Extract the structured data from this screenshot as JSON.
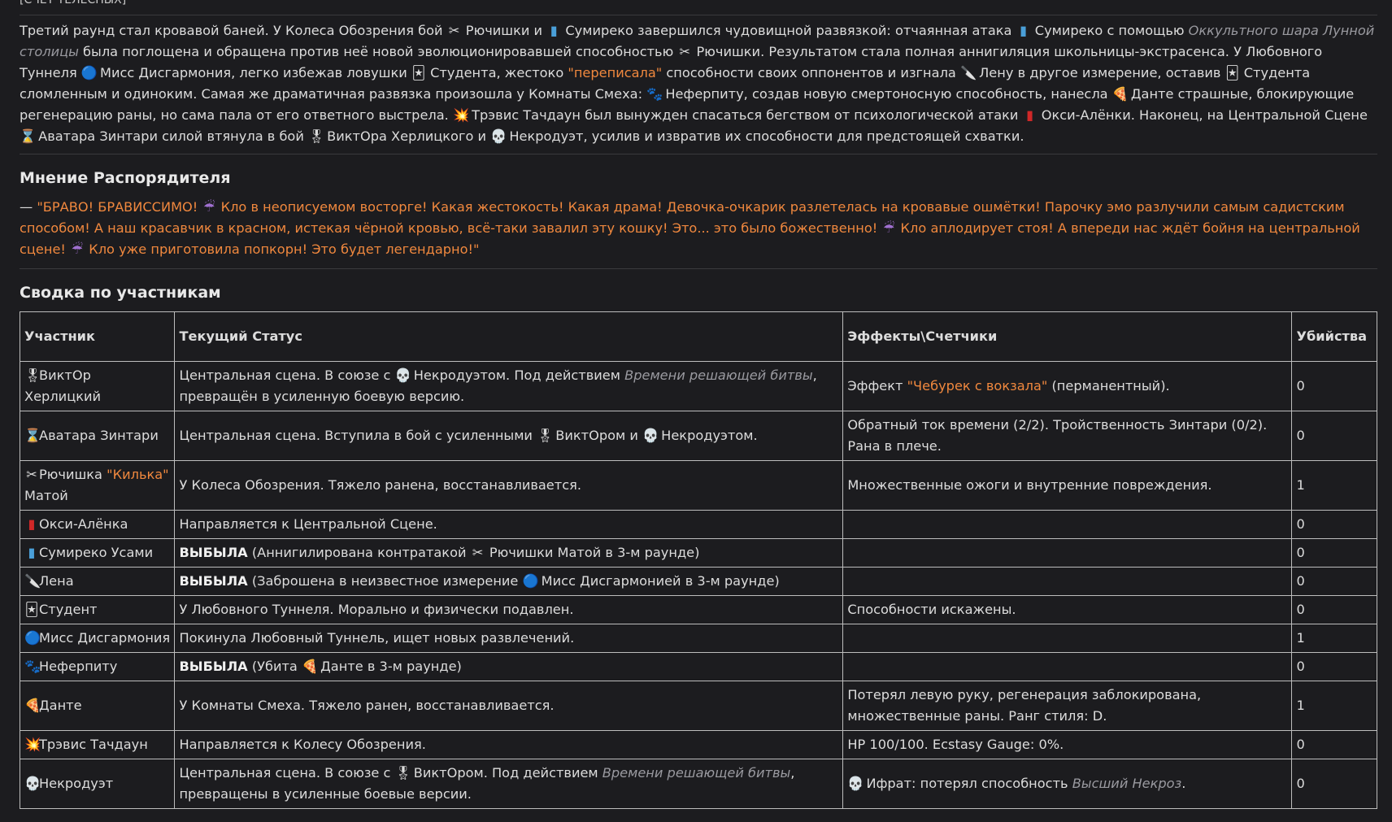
{
  "top_cut_text": "[СЧЕТ ТЕЛЕСНЫХ]",
  "story": {
    "s1": "Третий раунд стал кровавой баней. У Колеса Обозрения бой ",
    "s2": " Рючишки и ",
    "s3": " Сумиреко завершился чудовищной развязкой: отчаянная атака ",
    "s4": " Сумиреко с помощью ",
    "s4_it": "Оккультного шара Лунной столицы",
    "s5": " была поглощена и обращена против неё новой эволюционировавшей способностью ",
    "s6": " Рючишки. Результатом стала полная аннигиляция школьницы-экстрасенса. У Любовного Туннеля ",
    "s7": " Мисс Дисгармония, легко избежав ловушки ",
    "s8": " Студента, жестоко ",
    "s8_or": "\"переписала\"",
    "s9": " способности своих оппонентов и изгнала ",
    "s10": " Лену в другое измерение, оставив ",
    "s11": " Студента сломленным и одиноким. Самая же драматичная развязка произошла у Комнаты Смеха: ",
    "s12": " Неферпиту, создав новую смертоносную способность, нанесла ",
    "s13": " Данте страшные, блокирующие регенерацию раны, но сама пала от его ответного выстрела. ",
    "s14": " Трэвис Тачдаун был вынужден спасаться бегством от психологической атаки ",
    "s15": " Окси-Алёнки. Наконец, на Центральной Сцене ",
    "s16": " Аватара Зинтари силой втянула в бой ",
    "s17": " ВиктОра Херлицкого и ",
    "s18": " Некродуэт, усилив и извратив их способности для предстоящей схватки."
  },
  "opinion": {
    "heading": "Мнение Распорядителя",
    "dash": "— ",
    "q1": "\"БРАВО! БРАВИССИМО! ",
    "q2": " Кло в неописуемом восторге! Какая жестокость! Какая драма! Девочка-очкарик разлетелась на кровавые ошмётки! Парочку эмо разлучили самым садистским способом! А наш красавчик в красном, истекая чёрной кровью, всё-таки завалил эту кошку! Это... это было божественно! ",
    "q3": " Кло аплодирует стоя! А впереди нас ждёт бойня на центральной сцене! ",
    "q4": " Кло уже приготовила попкорн! Это будет легендарно!\""
  },
  "summary": {
    "heading": "Сводка по участникам",
    "columns": [
      "Участник",
      "Текущий Статус",
      "Эффекты\\Счетчики",
      "Убийства"
    ],
    "rows": [
      {
        "icon": "🎖",
        "name": "ВиктОр Херлицкий",
        "st1": "Центральная сцена. В союзе с ",
        "st_icon": "💀",
        "st2": " Некродуэтом. Под действием ",
        "st_it": "Времени решающей битвы",
        "st3": ", превращён в усиленную боевую версию.",
        "eff1": "Эффект ",
        "eff_or": "\"Чебурек с вокзала\"",
        "eff2": " (перманентный).",
        "kills": "0"
      },
      {
        "icon": "⌛",
        "name": "Аватара Зинтари",
        "st1": "Центральная сцена. Вступила в бой с усиленными ",
        "st_icon": "🎖",
        "st2": " ВиктОром и ",
        "st_icon2": "💀",
        "st3": " Некродуэтом.",
        "eff1": "Обратный ток времени (2/2). Тройственность Зинтари (0/2). Рана в плече.",
        "kills": "0"
      },
      {
        "icon": "✂",
        "name": "Рючишка ",
        "name_or": "\"Килька\"",
        "name2": " Матой",
        "st1": "У Колеса Обозрения. Тяжело ранена, восстанавливается.",
        "eff1": "Множественные ожоги и внутренние повреждения.",
        "kills": "1"
      },
      {
        "icon": "▮",
        "name": "Окси-Алёнка",
        "st1": "Направляется к Центральной Сцене.",
        "eff1": "",
        "kills": "0"
      },
      {
        "icon": "▮",
        "name": "Сумиреко Усами",
        "st_b": "ВЫБЫЛА",
        "st1": " (Аннигилирована контратакой ",
        "st_icon": "✂",
        "st2": " Рючишки Матой в 3-м раунде)",
        "eff1": "",
        "kills": "0"
      },
      {
        "icon": "🔪",
        "name": "Лена",
        "st_b": "ВЫБЫЛА",
        "st1": " (Заброшена в неизвестное измерение ",
        "st_icon": "🔵",
        "st2": " Мисс Дисгармонией в 3-м раунде)",
        "eff1": "",
        "kills": "0"
      },
      {
        "icon": "🃏",
        "name": "Студент",
        "st1": "У Любовного Туннеля. Морально и физически подавлен.",
        "eff1": "Способности искажены.",
        "kills": "0"
      },
      {
        "icon": "🔵",
        "name": "Мисс Дисгармония",
        "st1": "Покинула Любовный Туннель, ищет новых развлечений.",
        "eff1": "",
        "kills": "1"
      },
      {
        "icon": "🐾",
        "name": "Неферпиту",
        "st_b": "ВЫБЫЛА",
        "st1": " (Убита ",
        "st_icon": "🍕",
        "st2": " Данте в 3-м раунде)",
        "eff1": "",
        "kills": "0"
      },
      {
        "icon": "🍕",
        "name": "Данте",
        "st1": "У Комнаты Смеха. Тяжело ранен, восстанавливается.",
        "eff1": "Потерял левую руку, регенерация заблокирована, множественные раны. Ранг стиля: D.",
        "kills": "1"
      },
      {
        "icon": "💥",
        "name": "Трэвис Тачдаун",
        "st1": "Направляется к Колесу Обозрения.",
        "eff1": "HP 100/100. Ecstasy Gauge: 0%.",
        "kills": "0"
      },
      {
        "icon": "💀",
        "name": "Некродуэт",
        "st1": "Центральная сцена. В союзе с ",
        "st_icon": "🎖",
        "st2": " ВиктОром. Под действием ",
        "st_it": "Времени решающей битвы",
        "st3": ", превращены в усиленные боевые версии.",
        "eff_icon": "💀",
        "eff1": " Ифрат: потерял способность ",
        "eff_it": "Высший Некроз",
        "eff2": ".",
        "kills": "0"
      }
    ]
  },
  "icons": {
    "scissors": "✂",
    "can": "▮",
    "dice": "🃏",
    "knife": "🔪",
    "orb": "🔵",
    "paw": "🐾",
    "pizza": "🍕",
    "boom": "💥",
    "lipstick": "▮",
    "hourglass": "⌛",
    "medal": "🎖",
    "skull": "💀",
    "umbrella": "☔"
  },
  "colors": {
    "background": "#1c1c1f",
    "text": "#dcdcdc",
    "accent_orange": "#f0883e",
    "italic_grey": "#9a9aa0"
  }
}
